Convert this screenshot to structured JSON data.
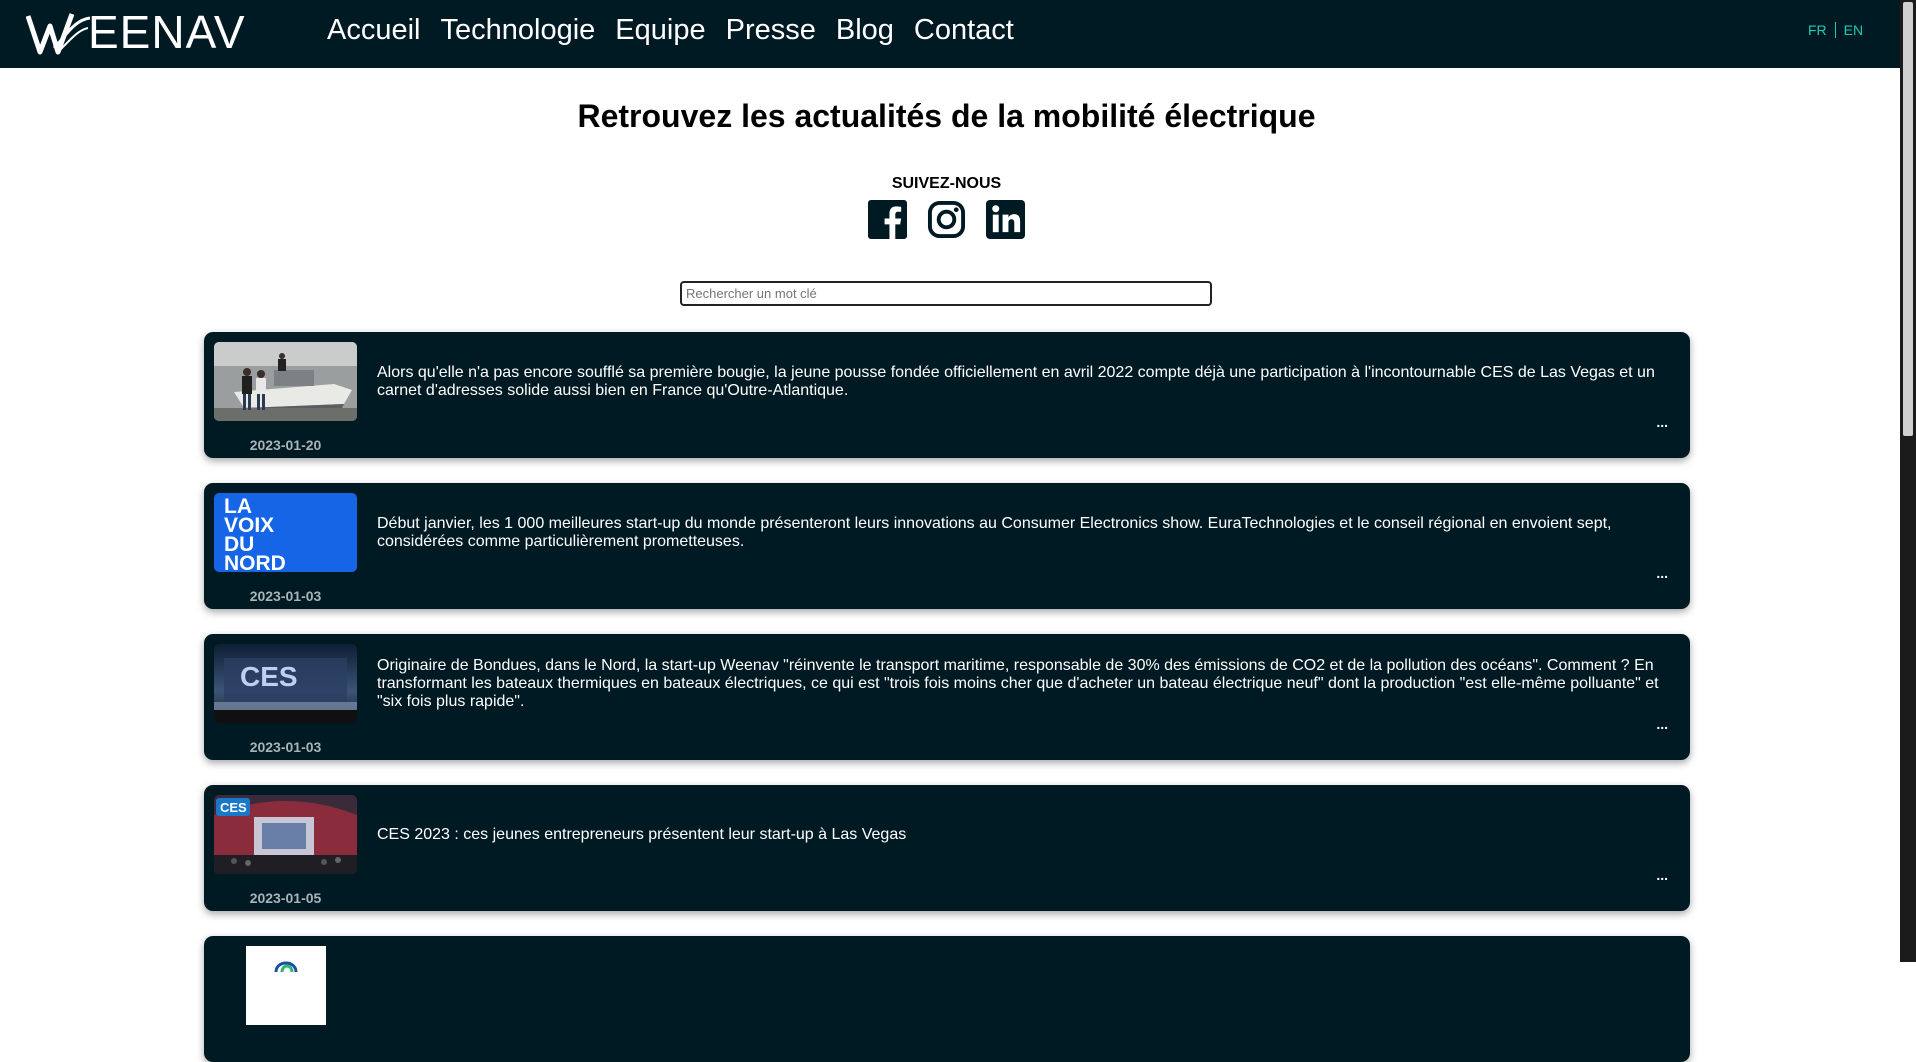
{
  "nav": {
    "logo_text": "EENAV",
    "links": [
      "Accueil",
      "Technologie",
      "Equipe",
      "Presse",
      "Blog",
      "Contact"
    ],
    "lang_fr": "FR",
    "lang_en": "EN"
  },
  "page": {
    "title": "Retrouvez les actualités de la mobilité électrique",
    "follow_label": "SUIVEZ-NOUS"
  },
  "search": {
    "placeholder": "Rechercher un mot clé"
  },
  "articles": [
    {
      "date": "2023-01-20",
      "text": "Alors qu'elle n'a pas encore soufflé sa première bougie, la jeune pousse fondée officiellement en avril 2022 compte déjà une participation à l'incontournable CES de Las Vegas et un carnet d'adresses solide aussi bien en France qu'Outre-Atlantique.",
      "more": "..."
    },
    {
      "date": "2023-01-03",
      "thumb_text": [
        "LA",
        "VOIX",
        "DU",
        "NORD"
      ],
      "text": "Début janvier, les 1 000 meilleures start-up du monde présenteront leurs innovations au Consumer Electronics show. EuraTechnologies et le conseil régional en envoient sept, considérées comme particulièrement prometteuses.",
      "more": "..."
    },
    {
      "date": "2023-01-03",
      "thumb_text": "CES",
      "text": "Originaire de Bondues, dans le Nord, la start-up Weenav \"réinvente le transport maritime, responsable de 30% des émissions de CO2 et de la pollution des océans\". Comment ? En transformant les bateaux thermiques en bateaux électriques, ce qui est \"trois fois moins cher que d'acheter un bateau électrique neuf\" dont la production \"est elle-même polluante\" et \"six fois plus rapide\".",
      "more": "..."
    },
    {
      "date": "2023-01-05",
      "thumb_text": "CES",
      "text": "CES 2023 : ces jeunes entrepreneurs présentent leur start-up à Las Vegas",
      "more": "..."
    }
  ],
  "colors": {
    "dark": "#001a23",
    "accent": "#20c9b6",
    "date": "#aab3b7",
    "voix_blue": "#1565e6"
  },
  "icons": [
    "facebook-icon",
    "instagram-icon",
    "linkedin-icon"
  ]
}
